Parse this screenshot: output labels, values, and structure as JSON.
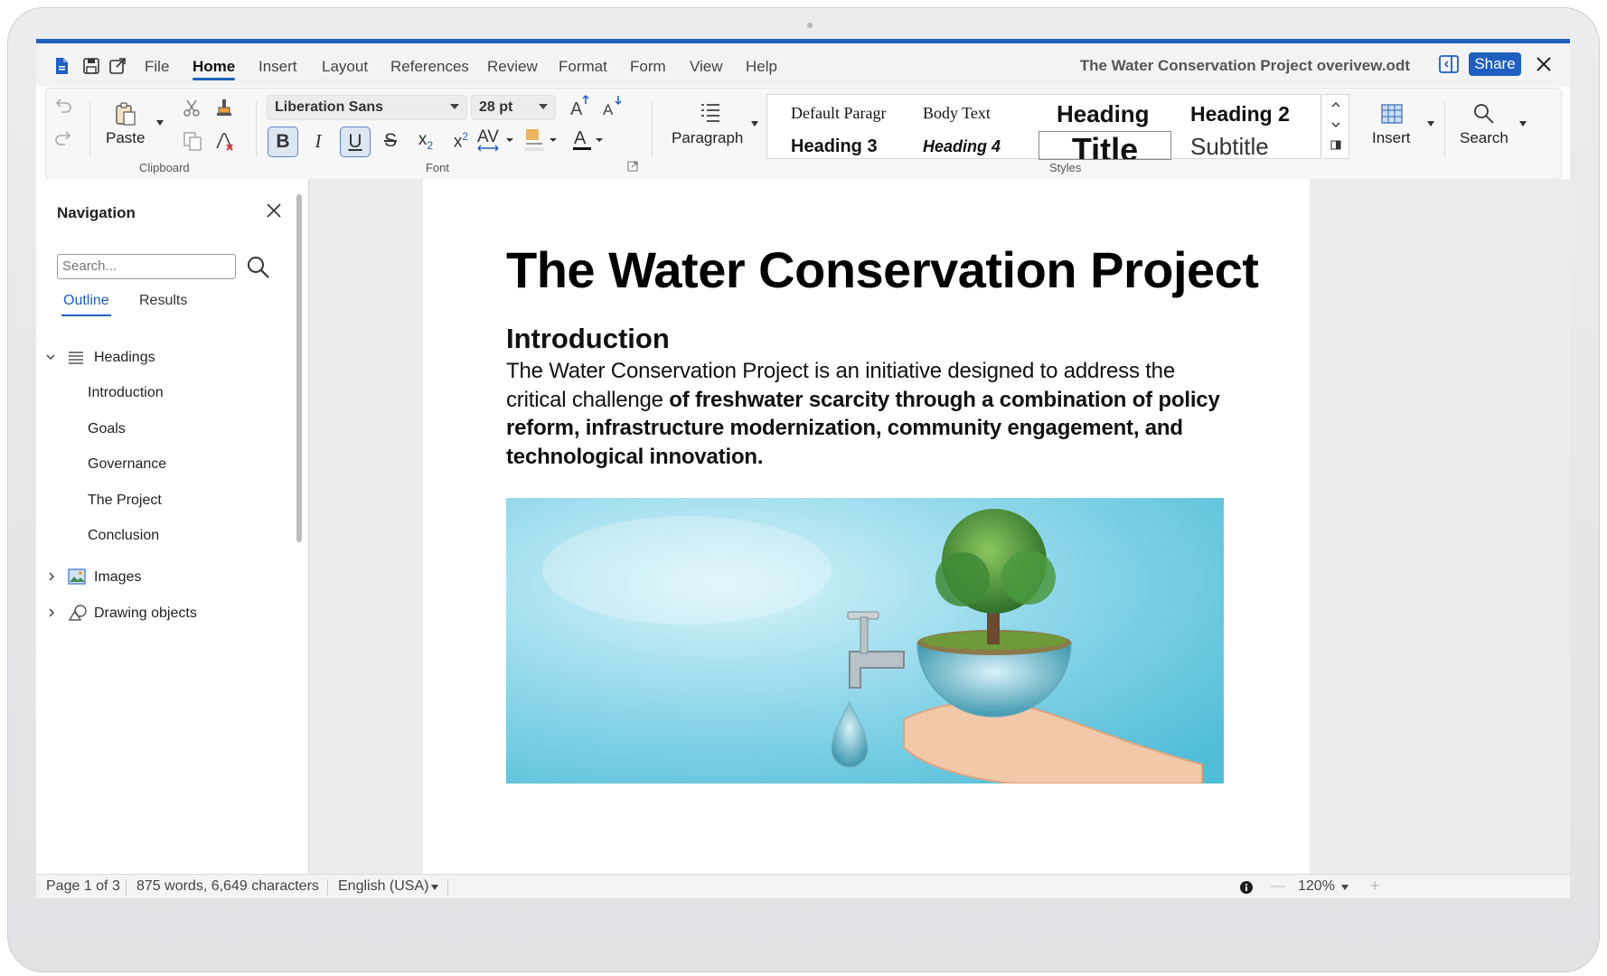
{
  "window": {
    "document_title": "The Water Conservation Project overivew.odt",
    "share_label": "Share"
  },
  "menu": {
    "items": [
      "File",
      "Home",
      "Insert",
      "Layout",
      "References",
      "Review",
      "Format",
      "Form",
      "View",
      "Help"
    ],
    "active": "Home"
  },
  "ribbon": {
    "clipboard": {
      "paste_label": "Paste",
      "group_label": "Clipboard"
    },
    "font": {
      "font_name": "Liberation Sans",
      "font_size": "28 pt",
      "group_label": "Font"
    },
    "paragraph": {
      "label": "Paragraph"
    },
    "styles": {
      "group_label": "Styles",
      "row1": [
        "Default Paragr",
        "Body Text",
        "Heading",
        "Heading 2"
      ],
      "row2": [
        "Heading 3",
        "Heading 4",
        "Title",
        "Subtitle"
      ]
    },
    "insert_label": "Insert",
    "search_label": "Search"
  },
  "navigation": {
    "title": "Navigation",
    "search_placeholder": "Search...",
    "tabs": [
      "Outline",
      "Results"
    ],
    "active_tab": "Outline",
    "headings_label": "Headings",
    "headings": [
      "Introduction",
      "Goals",
      "Governance",
      "The Project",
      "Conclusion"
    ],
    "images_label": "Images",
    "drawing_label": "Drawing objects"
  },
  "document": {
    "title": "The Water Conservation Project",
    "heading": "Introduction",
    "paragraph_regular": "The Water Conservation Project is an initiative designed to address the critical challenge ",
    "paragraph_bold": "of freshwater scarcity through a combination of policy reform, infrastructure modernization, community engagement, and technological innovation."
  },
  "status": {
    "page": "Page 1 of 3",
    "words": "875 words, 6,649 characters",
    "language": "English (USA)",
    "zoom": "120%"
  },
  "colors": {
    "accent": "#1f5fbf",
    "image_sky": "#7fd0e6"
  }
}
